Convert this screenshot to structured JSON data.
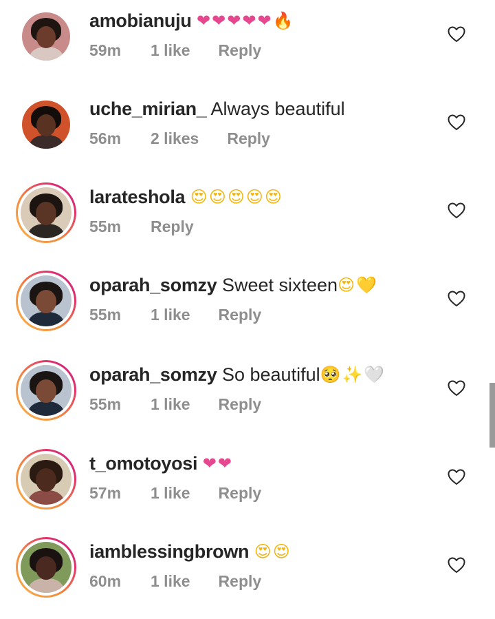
{
  "comments": [
    {
      "username": "amobianuju",
      "text": "",
      "emoji": [
        "heart",
        "heart",
        "heart",
        "heart",
        "heart",
        "fire"
      ],
      "time": "59m",
      "likes": "1 like",
      "reply": "Reply",
      "story_ring": false,
      "avatar_colors": {
        "bg": "#c98a8a",
        "face": "#6b3b2c",
        "hair": "#1e1410",
        "body": "#d9c8c2"
      }
    },
    {
      "username": "uche_mirian_",
      "text": "Always beautiful",
      "emoji": [],
      "time": "56m",
      "likes": "2 likes",
      "reply": "Reply",
      "story_ring": false,
      "avatar_colors": {
        "bg": "#d0522a",
        "face": "#5a3222",
        "hair": "#120c0a",
        "body": "#3a2a2a"
      }
    },
    {
      "username": "larateshola",
      "text": "",
      "emoji": [
        "heart-eyes",
        "heart-eyes",
        "heart-eyes",
        "heart-eyes",
        "heart-eyes"
      ],
      "time": "55m",
      "likes": "",
      "reply": "Reply",
      "story_ring": true,
      "avatar_colors": {
        "bg": "#d9cbb8",
        "face": "#5a3424",
        "hair": "#1c1410",
        "body": "#2b2622"
      }
    },
    {
      "username": "oparah_somzy",
      "text": "Sweet sixteen",
      "emoji": [
        "heart-eyes",
        "yellow-heart"
      ],
      "time": "55m",
      "likes": "1 like",
      "reply": "Reply",
      "story_ring": true,
      "avatar_colors": {
        "bg": "#b9c3cf",
        "face": "#7a4a36",
        "hair": "#1a1412",
        "body": "#1e2a3a"
      }
    },
    {
      "username": "oparah_somzy",
      "text": "So beautiful",
      "emoji": [
        "pleading",
        "sparkles",
        "white-heart"
      ],
      "time": "55m",
      "likes": "1 like",
      "reply": "Reply",
      "story_ring": true,
      "avatar_colors": {
        "bg": "#b9c3cf",
        "face": "#7a4a36",
        "hair": "#1a1412",
        "body": "#1e2a3a"
      }
    },
    {
      "username": "t_omotoyosi",
      "text": "",
      "emoji": [
        "heart",
        "heart"
      ],
      "time": "57m",
      "likes": "1 like",
      "reply": "Reply",
      "story_ring": true,
      "avatar_colors": {
        "bg": "#d8cbb4",
        "face": "#4d2a1e",
        "hair": "#2a1a12",
        "body": "#8a4c44"
      }
    },
    {
      "username": "iamblessingbrown",
      "text": "",
      "emoji": [
        "heart-eyes",
        "heart-eyes"
      ],
      "time": "60m",
      "likes": "1 like",
      "reply": "Reply",
      "story_ring": true,
      "avatar_colors": {
        "bg": "#7f9a5a",
        "face": "#4a2a20",
        "hair": "#1a1210",
        "body": "#c9b3a8"
      }
    }
  ],
  "icons": {
    "heart": "❤",
    "fire": "🔥",
    "heart-eyes": "😍",
    "yellow-heart": "💛",
    "pleading": "🥺",
    "sparkles": "✨",
    "white-heart": "🤍",
    "like_button": "heart-outline-icon"
  },
  "colors": {
    "text": "#262626",
    "meta": "#8e8e8e",
    "story_ring_start": "#f9b24a",
    "story_ring_end": "#c2198a"
  }
}
